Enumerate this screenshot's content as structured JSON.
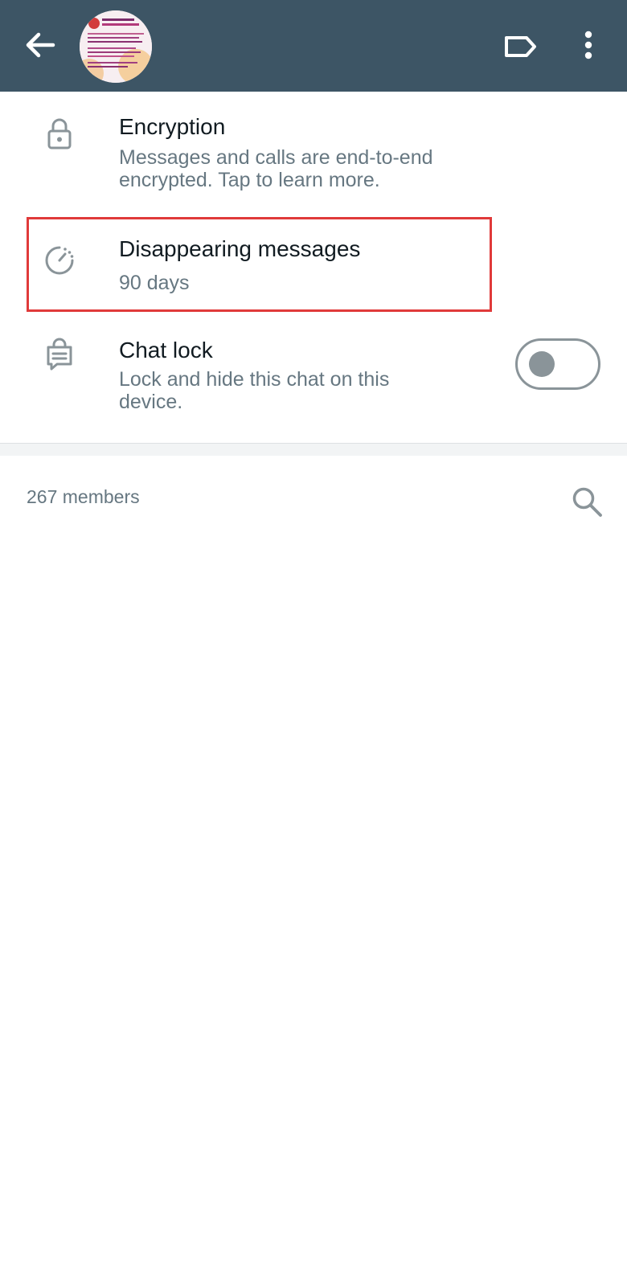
{
  "header": {
    "back_icon": "arrow-left-icon",
    "avatar": "group-avatar",
    "label_icon": "label-tag-icon",
    "menu_icon": "more-vertical-icon",
    "background_color": "#3d5565"
  },
  "settings": [
    {
      "id": "encryption",
      "icon": "lock-icon",
      "title": "Encryption",
      "subtitle": "Messages and calls are end-to-end encrypted. Tap to learn more."
    },
    {
      "id": "disappearing",
      "icon": "disappearing-timer-icon",
      "title": "Disappearing messages",
      "subtitle": "90 days",
      "highlighted": true,
      "highlight_color": "#e03a3a"
    },
    {
      "id": "chat_lock",
      "icon": "chat-lock-icon",
      "title": "Chat lock",
      "subtitle": "Lock and hide this chat on this device.",
      "toggle_on": false
    }
  ],
  "members": {
    "label": "267 members",
    "search_icon": "search-icon"
  }
}
